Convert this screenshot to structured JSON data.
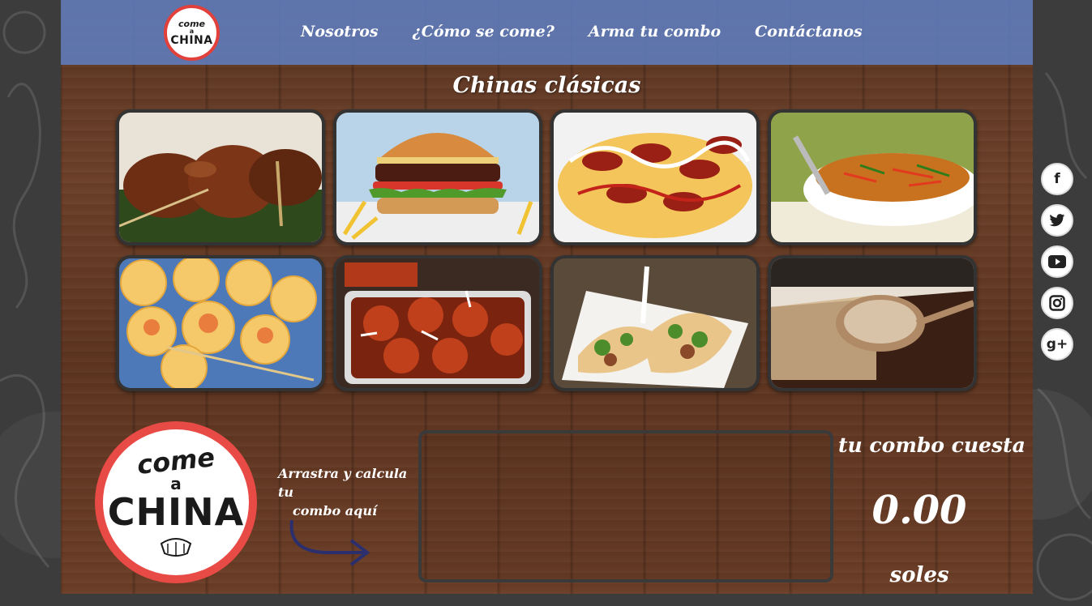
{
  "nav": {
    "logo": {
      "line1": "come",
      "line2": "a",
      "line3": "CHINA"
    },
    "links": [
      "Nosotros",
      "¿Cómo se come?",
      "Arma tu combo",
      "Contáctanos"
    ]
  },
  "section": {
    "title": "Chinas clásicas"
  },
  "tiles": [
    {
      "icon": "grilled-chicken-skewers"
    },
    {
      "icon": "burger-with-fries"
    },
    {
      "icon": "salchipapa-fries"
    },
    {
      "icon": "noodles-bowl"
    },
    {
      "icon": "siu-mai-dumplings"
    },
    {
      "icon": "sweet-sour-wantons"
    },
    {
      "icon": "tacos-tray"
    },
    {
      "icon": "soup-ladle"
    }
  ],
  "combo": {
    "logo": {
      "line1": "come",
      "line2": "a",
      "line3": "CHINA"
    },
    "hint_line1": "Arrastra y calcula tu",
    "hint_line2": "combo aquí",
    "price_label": "tu combo cuesta",
    "price_value": "0.00",
    "price_unit": "soles"
  },
  "social": [
    {
      "icon": "facebook-icon",
      "glyph": "f"
    },
    {
      "icon": "twitter-icon",
      "glyph": ""
    },
    {
      "icon": "youtube-icon",
      "glyph": ""
    },
    {
      "icon": "instagram-icon",
      "glyph": ""
    },
    {
      "icon": "google-plus-icon",
      "glyph": "g+"
    }
  ],
  "colors": {
    "navbar": "#5f7dbe",
    "logo_ring": "#e84a45",
    "wood": "#6b3f28"
  }
}
